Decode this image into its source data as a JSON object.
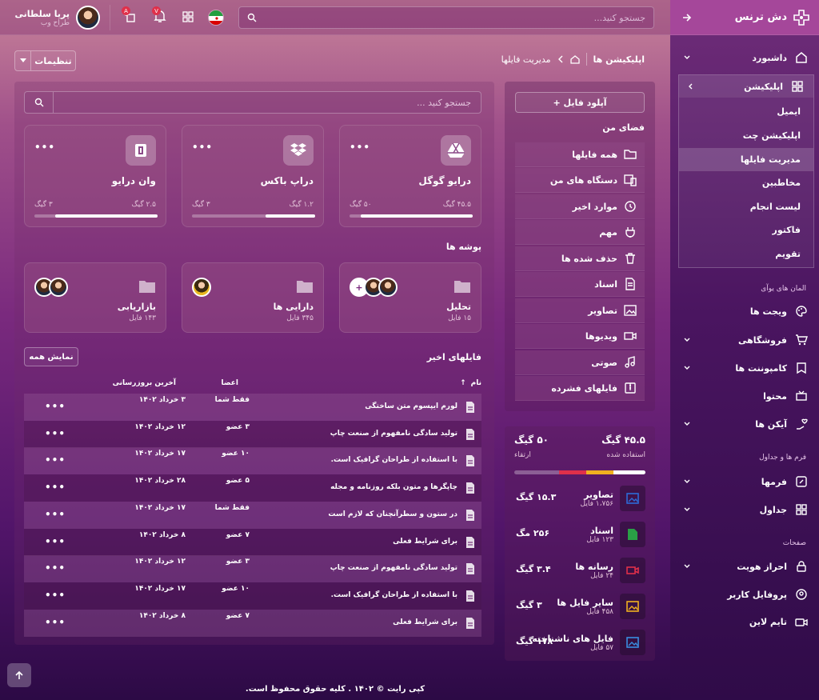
{
  "brand": "دش ترنس",
  "search": {
    "placeholder": "جستجو کنید..."
  },
  "user": {
    "name": "پریا سلطانی",
    "role": "طراح وب"
  },
  "badges": {
    "notifications": "V",
    "apps": "A"
  },
  "sidebar": {
    "items": [
      {
        "label": "داشبورد",
        "icon": "home-icon"
      },
      {
        "label": "اپلیکیشن",
        "icon": "grid-icon"
      }
    ],
    "sub": [
      "ایمیل",
      "اپلیکیشن چت",
      "مدیریت فایلها",
      "مخاطبین",
      "لیست انجام",
      "فاکتور",
      "تقویم"
    ],
    "section_ui": "المان های یوآی",
    "ui_items": [
      "ویجت ها",
      "فروشگاهی",
      "کامپوننت ها",
      "محتوا",
      "آیکن ها"
    ],
    "section_forms": "فرم ها و جداول",
    "form_items": [
      "فرمها",
      "جداول"
    ],
    "section_pages": "صفحات",
    "page_items": [
      "احراز هویت",
      "پروفایل کاربر",
      "تایم لاین"
    ]
  },
  "breadcrumb": {
    "root": "اپلیکیشن ها",
    "current": "مدیریت فایلها"
  },
  "settings_label": "تنظیمات",
  "left": {
    "upload": "+ آپلود فایل",
    "myspace": "فضای من",
    "menu": [
      "همه فایلها",
      "دستگاه های من",
      "موارد اخیر",
      "مهم",
      "حذف شده ها",
      "اسناد",
      "تصاویر",
      "ویدیوها",
      "صوتی",
      "فایلهای فشرده"
    ]
  },
  "storage": {
    "used": "۴۵.۵ گیگ",
    "used_label": "استفاده شده",
    "total": "۵۰ گیگ",
    "upgrade": "ارتقاء",
    "items": [
      {
        "name": "تصاویر",
        "count": "۱،۷۵۶ فایل",
        "size": "۱۵.۳ گیگ",
        "color": "#2e6bd8"
      },
      {
        "name": "اسناد",
        "count": "۱۲۳ فایل",
        "size": "۲۵۶ مگ",
        "color": "#2aa046"
      },
      {
        "name": "رسانه ها",
        "count": "۲۴ فایل",
        "size": "۳.۴ گیگ",
        "color": "#e0304a"
      },
      {
        "name": "سایر فایل ها",
        "count": "۴۵۸ فایل",
        "size": "۳ گیگ",
        "color": "#f0b020"
      },
      {
        "name": "فایل های ناشناخته",
        "count": "۵۷ فایل",
        "size": "۱۷۸ گیگ",
        "color": "#3a8ee0"
      }
    ]
  },
  "file_search": {
    "placeholder": "جستجو کنید ..."
  },
  "clouds": [
    {
      "name": "درایو گوگل",
      "used": "۴۵.۵ گیگ",
      "total": "۵۰ گیگ",
      "progress": 0.91
    },
    {
      "name": "دراپ باکس",
      "used": "۱.۲ گیگ",
      "total": "۳ گیگ",
      "progress": 0.4
    },
    {
      "name": "وان درایو",
      "used": "۲.۵ گیگ",
      "total": "۳ گیگ",
      "progress": 0.83
    }
  ],
  "folders_title": "پوشه ها",
  "folders": [
    {
      "name": "تحلیل",
      "count": "۱۵ فایل"
    },
    {
      "name": "دارایی ها",
      "count": "۳۴۵ فایل"
    },
    {
      "name": "بازاریابی",
      "count": "۱۴۳ فایل"
    }
  ],
  "recent": {
    "title": "فایلهای اخیر",
    "show_all": "نمایش همه",
    "headers": {
      "name": "نام",
      "members": "اعضا",
      "updated": "آخرین بروزرسانی"
    },
    "rows": [
      {
        "name": "لورم ایپسوم متن ساختگی",
        "members": "فقط شما",
        "date": "۳ خرداد ۱۴۰۲"
      },
      {
        "name": "تولید سادگی نامفهوم از صنعت چاپ",
        "members": "۳ عضو",
        "date": "۱۲ خرداد ۱۴۰۲"
      },
      {
        "name": "با استفاده از طراحان گرافیک است.",
        "members": "۱۰ عضو",
        "date": "۱۷ خرداد ۱۴۰۲"
      },
      {
        "name": "چاپگرها و متون بلکه روزنامه و مجله",
        "members": "۵ عضو",
        "date": "۲۸ خرداد ۱۴۰۲"
      },
      {
        "name": "در ستون و سطرآنچنان که لازم است",
        "members": "فقط شما",
        "date": "۱۷ خرداد ۱۴۰۲"
      },
      {
        "name": "برای شرایط فعلی",
        "members": "۷ عضو",
        "date": "۸ خرداد ۱۴۰۲"
      },
      {
        "name": "تولید سادگی نامفهوم از صنعت چاپ",
        "members": "۳ عضو",
        "date": "۱۲ خرداد ۱۴۰۲"
      },
      {
        "name": "با استفاده از طراحان گرافیک است.",
        "members": "۱۰ عضو",
        "date": "۱۷ خرداد ۱۴۰۲"
      },
      {
        "name": "برای شرایط فعلی",
        "members": "۷ عضو",
        "date": "۸ خرداد ۱۴۰۲"
      }
    ]
  },
  "footer": "کپی رایت © ۱۴۰۲ . کلیه حقوق محفوظ است."
}
